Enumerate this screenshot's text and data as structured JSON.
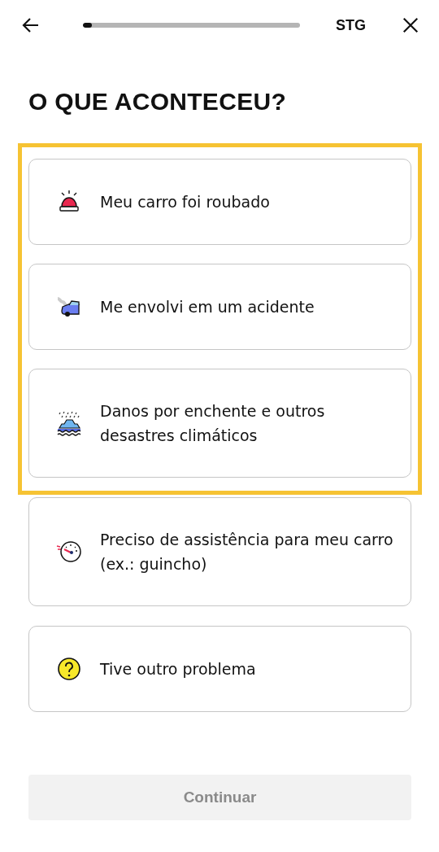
{
  "header": {
    "progress": {
      "level": 0.04
    },
    "env_label": "STG"
  },
  "title": "O QUE ACONTECEU?",
  "options": [
    {
      "kind": "siren",
      "label": "Meu carro foi roubado",
      "highlighted": true
    },
    {
      "kind": "crash",
      "label": "Me envolvi em um acidente",
      "highlighted": true
    },
    {
      "kind": "flood",
      "label": "Danos por enchente e outros desastres climáticos",
      "highlighted": true
    },
    {
      "kind": "gauge",
      "label": "Preciso de assistência para meu carro (ex.: guincho)",
      "highlighted": false
    },
    {
      "kind": "question",
      "label": "Tive outro problema",
      "highlighted": false
    }
  ],
  "continue_button": {
    "label": "Continuar",
    "disabled": true
  }
}
